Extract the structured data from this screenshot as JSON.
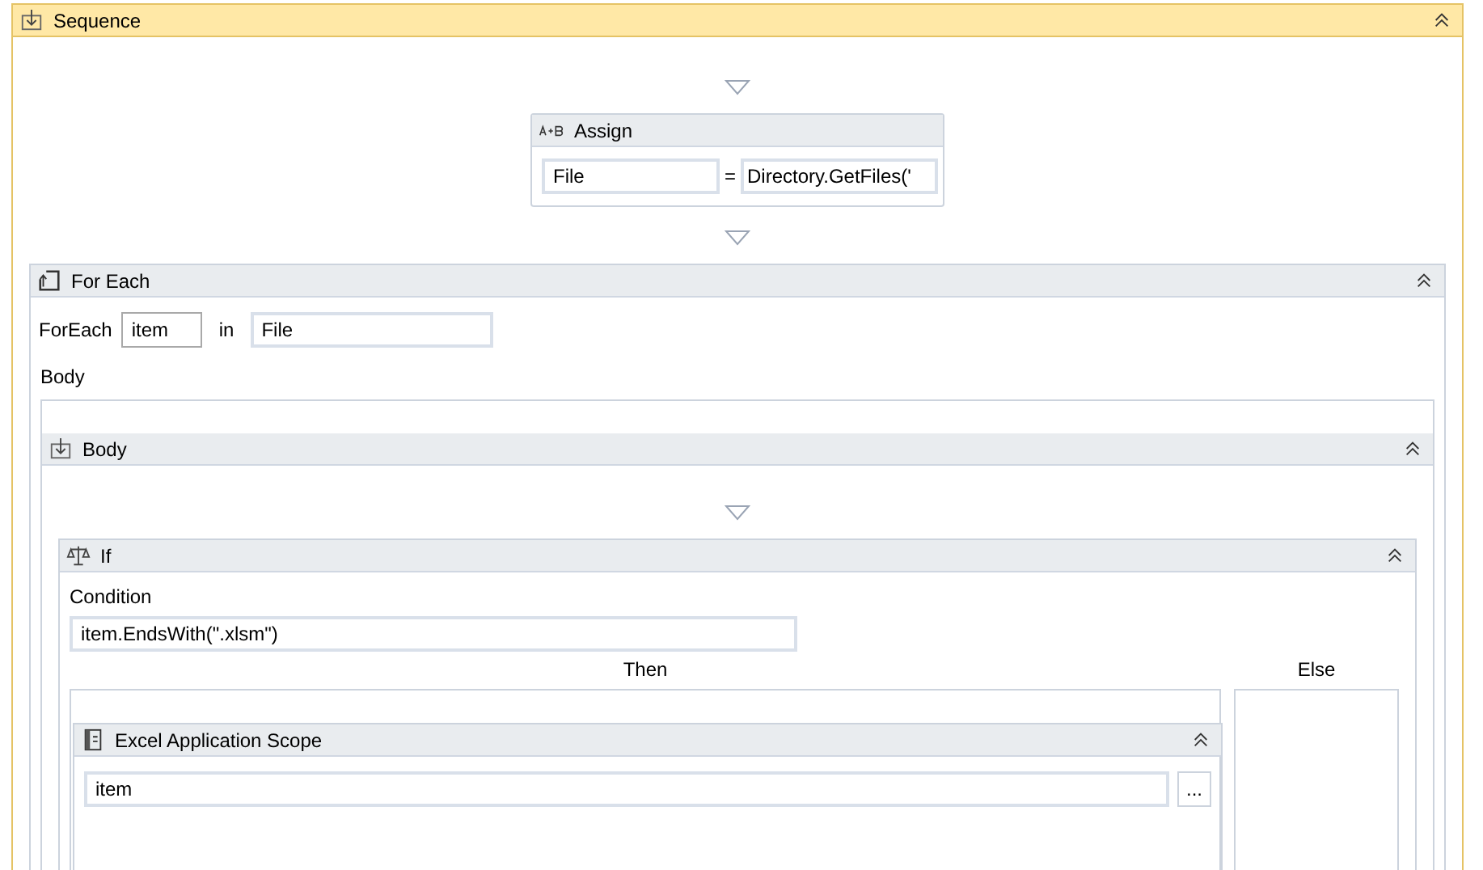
{
  "sequence": {
    "title": "Sequence",
    "assign": {
      "title": "Assign",
      "to": "File",
      "operator": "=",
      "value": "Directory.GetFiles('"
    },
    "for_each": {
      "title": "For Each",
      "keyword": "ForEach",
      "variable": "item",
      "in_label": "in",
      "collection": "File",
      "body_label": "Body",
      "body": {
        "title": "Body",
        "if": {
          "title": "If",
          "condition_label": "Condition",
          "condition": "item.EndsWith(\".xlsm\")",
          "then_label": "Then",
          "else_label": "Else",
          "excel_scope": {
            "title": "Excel Application Scope",
            "path": "item",
            "browse": "..."
          }
        }
      }
    }
  }
}
